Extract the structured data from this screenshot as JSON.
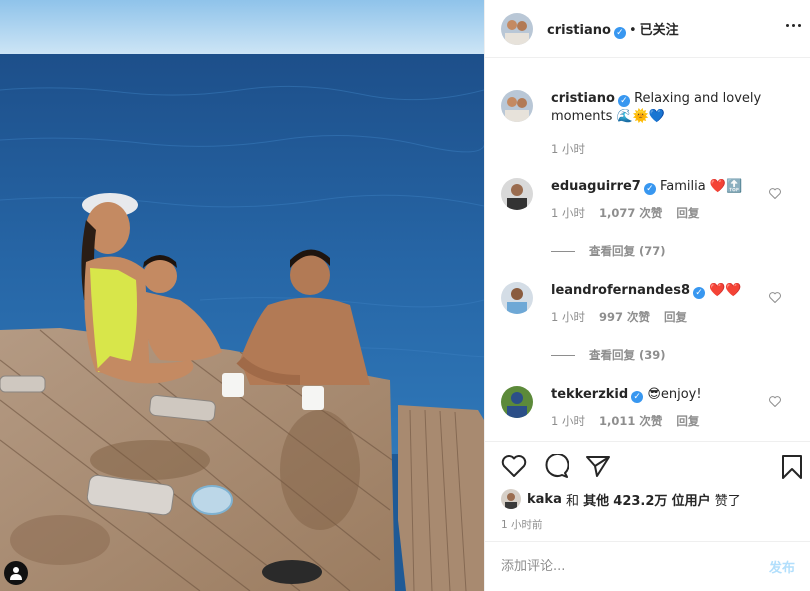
{
  "post": {
    "username": "cristiano",
    "verified": true,
    "follow_status": "已关注",
    "separator": "•"
  },
  "caption": {
    "username": "cristiano",
    "text": "Relaxing and lovely moments 🌊🌞💙",
    "time": "1 小时"
  },
  "comments": [
    {
      "username": "eduaguirre7",
      "verified": true,
      "text": "Familia ❤️🔝",
      "time": "1 小时",
      "likes": "1,077 次赞",
      "reply": "回复",
      "view_replies": "查看回复 (77)"
    },
    {
      "username": "leandrofernandes8",
      "verified": true,
      "text": "❤️❤️",
      "time": "1 小时",
      "likes": "997 次赞",
      "reply": "回复",
      "view_replies": "查看回复 (39)"
    },
    {
      "username": "tekkerzkid",
      "verified": true,
      "text": "😎enjoy!",
      "time": "1 小时",
      "likes": "1,011 次赞",
      "reply": "回复"
    }
  ],
  "likes": {
    "user": "kaka",
    "text_and": "和",
    "text_others": "其他",
    "count": "423.2万",
    "text_suffix": "位用户",
    "liked": "赞了"
  },
  "timestamp": "1 小时前",
  "comment_box": {
    "placeholder": "添加评论...",
    "post_label": "发布"
  },
  "icons": {
    "like": "heart-icon",
    "comment": "comment-icon",
    "share": "paper-plane-icon",
    "save": "bookmark-icon",
    "more": "more-options-icon",
    "tag": "user-tag-icon"
  },
  "colors": {
    "verified": "#3897f0",
    "muted": "#8e8e8e",
    "post_button": "#b2dffc"
  }
}
